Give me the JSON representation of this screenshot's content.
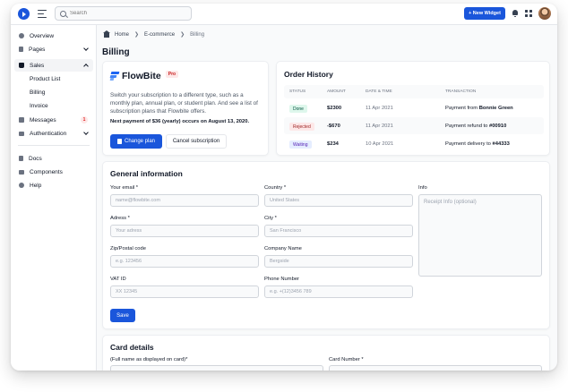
{
  "topbar": {
    "search_placeholder": "Search",
    "new_widget_label": "+ New Widget"
  },
  "sidebar": {
    "items": [
      {
        "label": "Overview",
        "icon": "pie-chart-icon"
      },
      {
        "label": "Pages",
        "icon": "document-icon"
      },
      {
        "label": "Sales",
        "icon": "shopping-bag-icon"
      },
      {
        "label": "Messages",
        "icon": "inbox-icon",
        "badge": "1"
      },
      {
        "label": "Authentication",
        "icon": "lock-icon"
      }
    ],
    "sales_subitems": [
      "Product List",
      "Billing",
      "Invoice"
    ],
    "bottom_items": [
      {
        "label": "Docs",
        "icon": "clipboard-icon"
      },
      {
        "label": "Components",
        "icon": "stack-icon"
      },
      {
        "label": "Help",
        "icon": "lifebuoy-icon"
      }
    ]
  },
  "breadcrumb": {
    "home": "Home",
    "section": "E-commerce",
    "current": "Billing"
  },
  "page_title": "Billing",
  "flowbite": {
    "brand": "FlowBite",
    "badge": "Pro",
    "description": "Switch your subscription to a different type, such as a monthly plan, annual plan, or student plan. And see a list of subscription plans that Flowbite offers.",
    "next_payment": "Next payment of $36 (yearly) occurs on August 13, 2020.",
    "change_plan": "Change plan",
    "cancel_subscription": "Cancel subscription"
  },
  "order_history": {
    "title": "Order History",
    "columns": [
      "Status",
      "Amount",
      "Date & Time",
      "Transaction"
    ],
    "rows": [
      {
        "status": "Done",
        "amount": "$2300",
        "date": "11 Apr 2021",
        "txn_prefix": "Payment from ",
        "txn_bold": "Bonnie Green"
      },
      {
        "status": "Rejected",
        "amount": "-$670",
        "date": "11 Apr 2021",
        "txn_prefix": "Payment refund to ",
        "txn_bold": "#00910"
      },
      {
        "status": "Waiting",
        "amount": "$234",
        "date": "10 Apr 2021",
        "txn_prefix": "Payment delivery to ",
        "txn_bold": "#44333"
      }
    ]
  },
  "general_info": {
    "title": "General information",
    "email_label": "Your email *",
    "email_placeholder": "name@flowbite.com",
    "country_label": "Country *",
    "country_placeholder": "United States",
    "info_label": "Info",
    "info_placeholder": "Receipt Info (optional)",
    "address_label": "Adress *",
    "address_placeholder": "Your adress",
    "city_label": "City *",
    "city_placeholder": "San Francisco",
    "zip_label": "Zip/Postal code",
    "zip_placeholder": "e.g. 123456",
    "company_label": "Company Name",
    "company_placeholder": "Bergside",
    "vat_label": "VAT ID",
    "vat_placeholder": "XX 12345",
    "phone_label": "Phone Number",
    "phone_placeholder": "e.g. +(12)3456 789",
    "save_label": "Save"
  },
  "card_details": {
    "title": "Card details",
    "name_label": "(Full name as displayed on card)*",
    "number_label": "Card Number *"
  }
}
